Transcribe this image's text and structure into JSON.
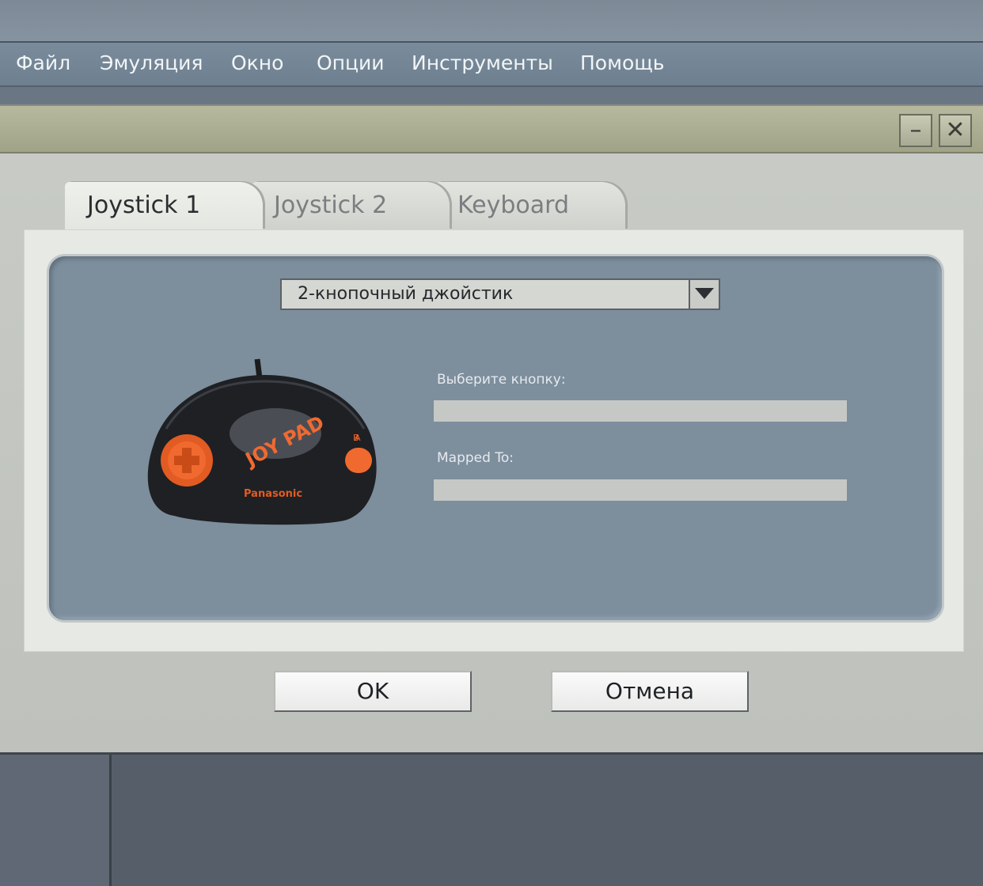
{
  "menu": {
    "items": [
      {
        "label": "Файл"
      },
      {
        "label": "Эмуляция"
      },
      {
        "label": "Окно"
      },
      {
        "label": "Опции"
      },
      {
        "label": "Инструменты"
      },
      {
        "label": "Помощь"
      }
    ]
  },
  "dialog": {
    "tabs": [
      {
        "label": "Joystick 1",
        "active": true
      },
      {
        "label": "Joystick 2",
        "active": false
      },
      {
        "label": "Keyboard",
        "active": false
      }
    ],
    "device_select": {
      "value": "2-кнопочный джойстик"
    },
    "fields": [
      {
        "label": "Выберите кнопку:",
        "value": ""
      },
      {
        "label": "Mapped To:",
        "value": ""
      }
    ],
    "joypad": {
      "brand": "Panasonic",
      "logo": "JOY PAD",
      "button_b": "B",
      "button_a": "A"
    },
    "ok_label": "OK",
    "cancel_label": "Отмена"
  },
  "icons": {
    "minimize": "minimize-icon",
    "close": "close-icon",
    "dropdown": "chevron-down-icon"
  },
  "colors": {
    "menubar": "#728494",
    "titlebar": "#a9ab91",
    "panel": "#7d8e9d",
    "joypad_accent": "#f06a30"
  }
}
